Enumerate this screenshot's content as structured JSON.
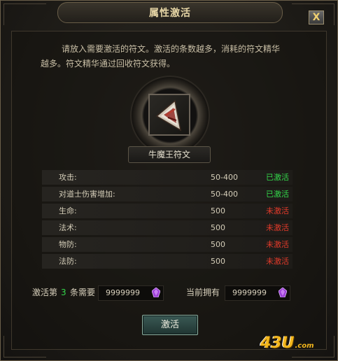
{
  "window": {
    "title": "属性激活",
    "close_label": "X"
  },
  "description": {
    "line1": "请放入需要激活的符文。激活的条数越多，消耗的符文精华",
    "line2": "越多。符文精华通过回收符文获得。"
  },
  "rune": {
    "name": "牛魔王符文",
    "icon": "triangle-rune-icon"
  },
  "attributes": [
    {
      "name": "攻击:",
      "value": "50-400",
      "status": "已激活",
      "status_color": "#33d64a"
    },
    {
      "name": "对道士伤害增加:",
      "value": "50-400",
      "status": "已激活",
      "status_color": "#33d64a"
    },
    {
      "name": "生命:",
      "value": "500",
      "status": "未激活",
      "status_color": "#e23a2a"
    },
    {
      "name": "法术:",
      "value": "500",
      "status": "未激活",
      "status_color": "#e23a2a"
    },
    {
      "name": "物防:",
      "value": "500",
      "status": "未激活",
      "status_color": "#e23a2a"
    },
    {
      "name": "法防:",
      "value": "500",
      "status": "未激活",
      "status_color": "#e23a2a"
    }
  ],
  "cost": {
    "prefix": "激活第",
    "index": "3",
    "suffix": "条需要",
    "required": "9999999",
    "owned_label": "当前拥有",
    "owned": "9999999",
    "currency_icon": "purple-gem-icon"
  },
  "activate_button": "激活",
  "watermark": {
    "number": "43U",
    "suffix": ".com"
  }
}
